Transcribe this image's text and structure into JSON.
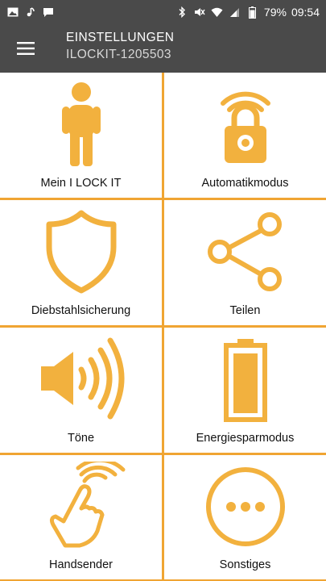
{
  "status_bar": {
    "battery_percent": "79%",
    "time": "09:54",
    "left_icons": [
      "image-icon",
      "notification-icon",
      "message-icon"
    ],
    "right_icons": [
      "bluetooth-icon",
      "mute-icon",
      "wifi-icon",
      "signal-icon",
      "battery-icon"
    ]
  },
  "app_bar": {
    "title": "EINSTELLUNGEN",
    "subtitle": "ILOCKIT-1205503",
    "menu_icon": "hamburger-menu-icon",
    "background": "#4a4a4a"
  },
  "colors": {
    "accent": "#f0a533",
    "icon": "#f2b13e"
  },
  "tiles": [
    {
      "label": "Mein I LOCK IT",
      "icon": "person-icon"
    },
    {
      "label": "Automatikmodus",
      "icon": "lock-wireless-icon"
    },
    {
      "label": "Diebstahlsicherung",
      "icon": "shield-icon"
    },
    {
      "label": "Teilen",
      "icon": "share-icon"
    },
    {
      "label": "Töne",
      "icon": "speaker-icon"
    },
    {
      "label": "Energiesparmodus",
      "icon": "battery-icon"
    },
    {
      "label": "Handsender",
      "icon": "hand-tap-icon"
    },
    {
      "label": "Sonstiges",
      "icon": "more-icon"
    }
  ]
}
